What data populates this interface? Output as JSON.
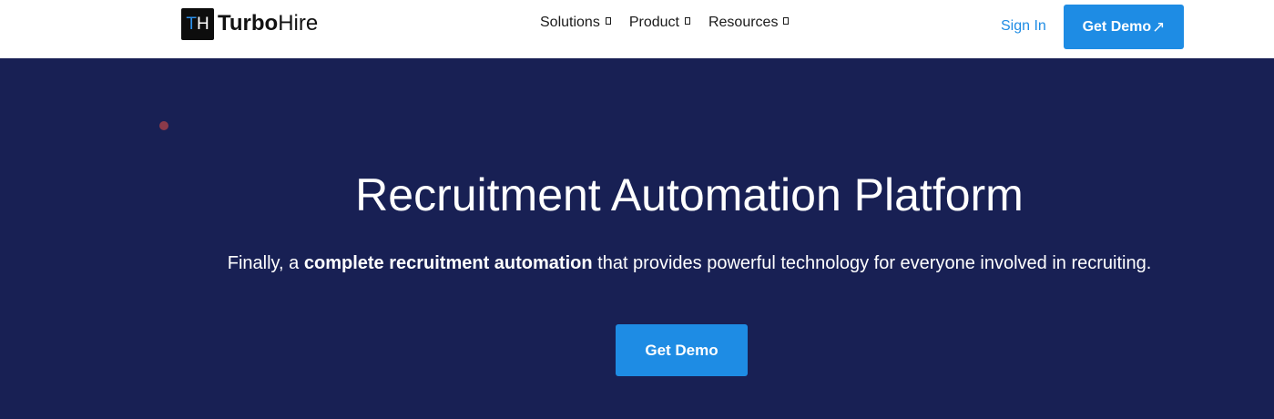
{
  "brand": {
    "logo_mark_t": "T",
    "logo_mark_h": "H",
    "name_bold": "Turbo",
    "name_light": "Hire",
    "accent_color": "#1e8ce4",
    "hero_background": "#182054"
  },
  "nav": {
    "items": [
      {
        "label": "Solutions",
        "icon": "chevron-down-icon"
      },
      {
        "label": "Product",
        "icon": "chevron-down-icon"
      },
      {
        "label": "Resources",
        "icon": "chevron-down-icon"
      }
    ],
    "signin_label": "Sign In",
    "demo_label": "Get Demo",
    "demo_icon": "arrow-up-right-icon",
    "demo_arrow": "↗"
  },
  "hero": {
    "title": "Recruitment Automation Platform",
    "subtitle_pre": "Finally, a ",
    "subtitle_bold": "complete recruitment automation",
    "subtitle_post": " that provides powerful technology for everyone involved in recruiting.",
    "cta_label": "Get Demo"
  }
}
